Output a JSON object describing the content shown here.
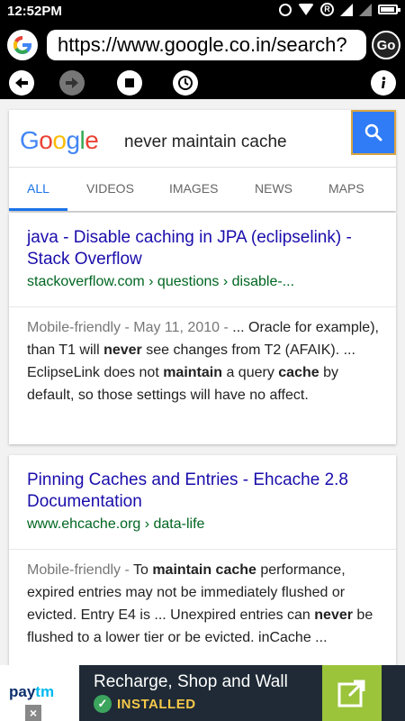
{
  "status_bar": {
    "time": "12:52PM",
    "icons": [
      "alarm-icon",
      "wifi-icon",
      "registered-icon",
      "signal-icon",
      "signal-icon",
      "battery-icon"
    ]
  },
  "browser": {
    "logo_letter": "G",
    "url": "https://www.google.co.in/search?",
    "go_label": "Go"
  },
  "google": {
    "wordmark": [
      {
        "ch": "G",
        "color": "#4285f4"
      },
      {
        "ch": "o",
        "color": "#ea4335"
      },
      {
        "ch": "o",
        "color": "#fbbc05"
      },
      {
        "ch": "g",
        "color": "#4285f4"
      },
      {
        "ch": "l",
        "color": "#34a853"
      },
      {
        "ch": "e",
        "color": "#ea4335"
      }
    ],
    "query": "never maintain cache",
    "tabs": [
      "ALL",
      "VIDEOS",
      "IMAGES",
      "NEWS",
      "MAPS"
    ],
    "active_tab": "ALL",
    "accent": "#1a73e8"
  },
  "results": [
    {
      "title": "java - Disable caching in JPA (eclipselink) - Stack Overflow",
      "url": "stackoverflow.com › questions › disable-...",
      "meta": "Mobile-friendly - May 11, 2010 - ",
      "snippet_parts": [
        {
          "t": "... Oracle for example), than T1 will ",
          "b": false
        },
        {
          "t": "never",
          "b": true
        },
        {
          "t": " see changes from T2 (AFAIK). ... EclipseLink does not ",
          "b": false
        },
        {
          "t": "maintain",
          "b": true
        },
        {
          "t": " a query ",
          "b": false
        },
        {
          "t": "cache",
          "b": true
        },
        {
          "t": " by default, so those settings will have no affect.",
          "b": false
        }
      ]
    },
    {
      "title": "Pinning Caches and Entries - Ehcache 2.8 Documentation",
      "url": "www.ehcache.org › data-life",
      "meta": "Mobile-friendly - ",
      "snippet_parts": [
        {
          "t": "To ",
          "b": false
        },
        {
          "t": "maintain cache",
          "b": true
        },
        {
          "t": " performance, expired entries may not be immediately flushed or evicted. Entry E4 is ... Unexpired entries can ",
          "b": false
        },
        {
          "t": "never",
          "b": true
        },
        {
          "t": " be flushed to a lower tier or be evicted. inCache ...",
          "b": false
        }
      ]
    }
  ],
  "ad": {
    "brand": "Paytm",
    "text": "Recharge, Shop and Wall",
    "status": "INSTALLED",
    "close": "×",
    "colors": {
      "brand_dark": "#0b2f6b",
      "brand_light": "#00b9f1",
      "installed": "#f7c948",
      "action": "#9bc43b"
    }
  }
}
